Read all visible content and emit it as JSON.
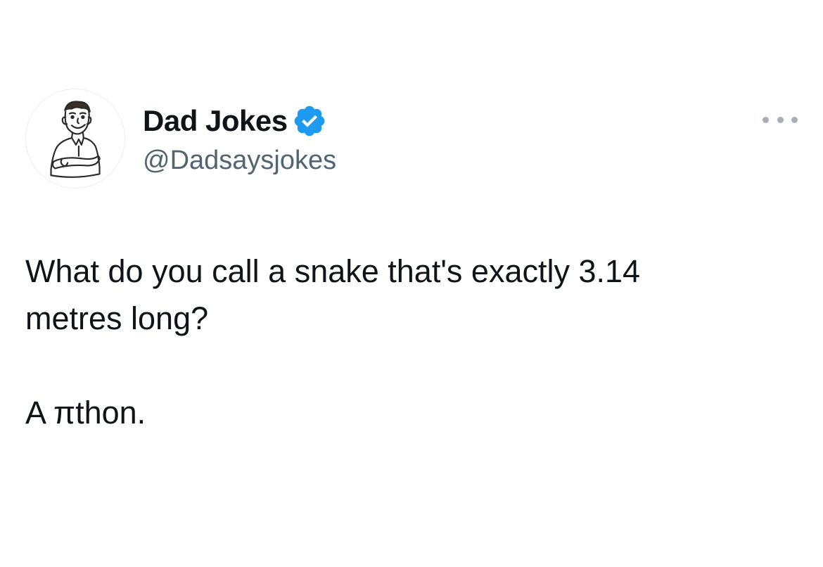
{
  "author": {
    "display_name": "Dad Jokes",
    "handle": "@Dadsaysjokes",
    "verified": true,
    "avatar_icon": "cartoon-man-arms-crossed",
    "verified_color": "#1d9bf0"
  },
  "menu": {
    "icon": "more-horizontal-icon"
  },
  "tweet": {
    "line1": "What do you call a snake that's exactly 3.14",
    "line2": "metres long?",
    "punchline": "A πthon."
  },
  "colors": {
    "text": "#0f1419",
    "secondary_text": "#536471",
    "background": "#ffffff"
  }
}
